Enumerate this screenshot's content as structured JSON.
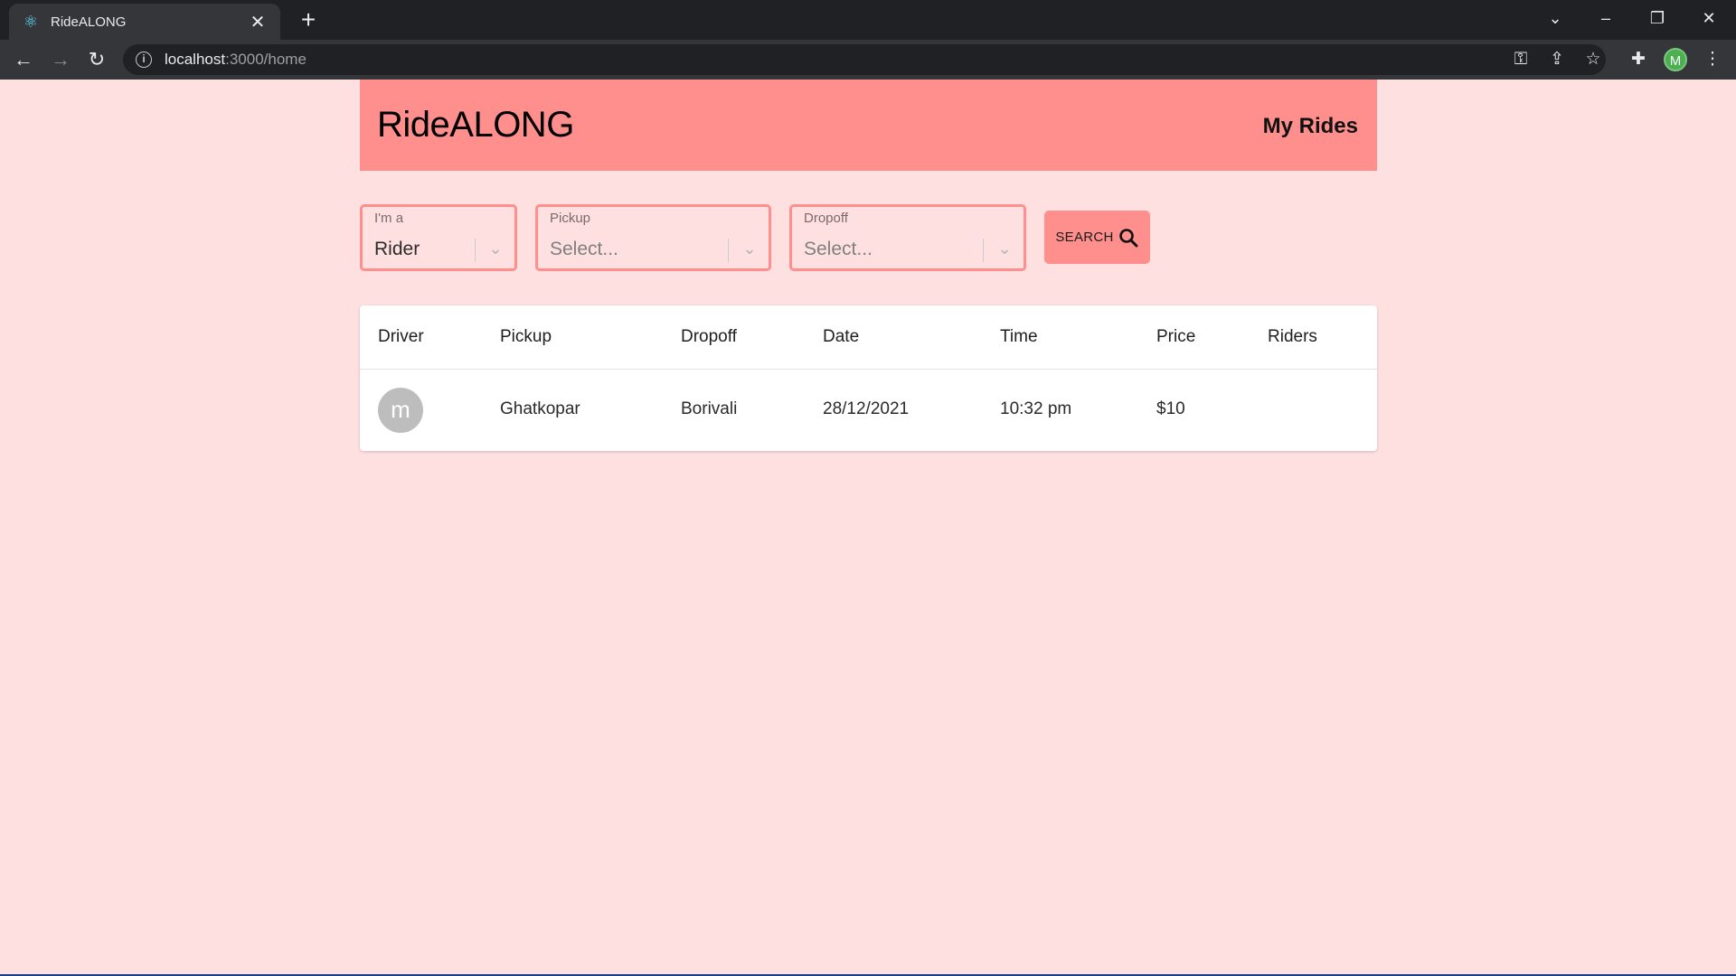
{
  "browser": {
    "tab_title": "RideALONG",
    "url_host": "localhost",
    "url_path": ":3000/home",
    "profile_initial": "M"
  },
  "header": {
    "brand": "RideALONG",
    "my_rides": "My Rides"
  },
  "filters": {
    "role": {
      "label": "I'm a",
      "value": "Rider"
    },
    "pickup": {
      "label": "Pickup",
      "placeholder": "Select..."
    },
    "dropoff": {
      "label": "Dropoff",
      "placeholder": "Select..."
    },
    "search_label": "SEARCH"
  },
  "table": {
    "columns": [
      "Driver",
      "Pickup",
      "Dropoff",
      "Date",
      "Time",
      "Price",
      "Riders"
    ],
    "rows": [
      {
        "driver_initial": "m",
        "pickup": "Ghatkopar",
        "dropoff": "Borivali",
        "date": "28/12/2021",
        "time": "10:32 pm",
        "price": "$10",
        "riders": ""
      }
    ]
  },
  "colors": {
    "page_bg": "#ffe0e1",
    "accent": "#ff8f8c"
  }
}
